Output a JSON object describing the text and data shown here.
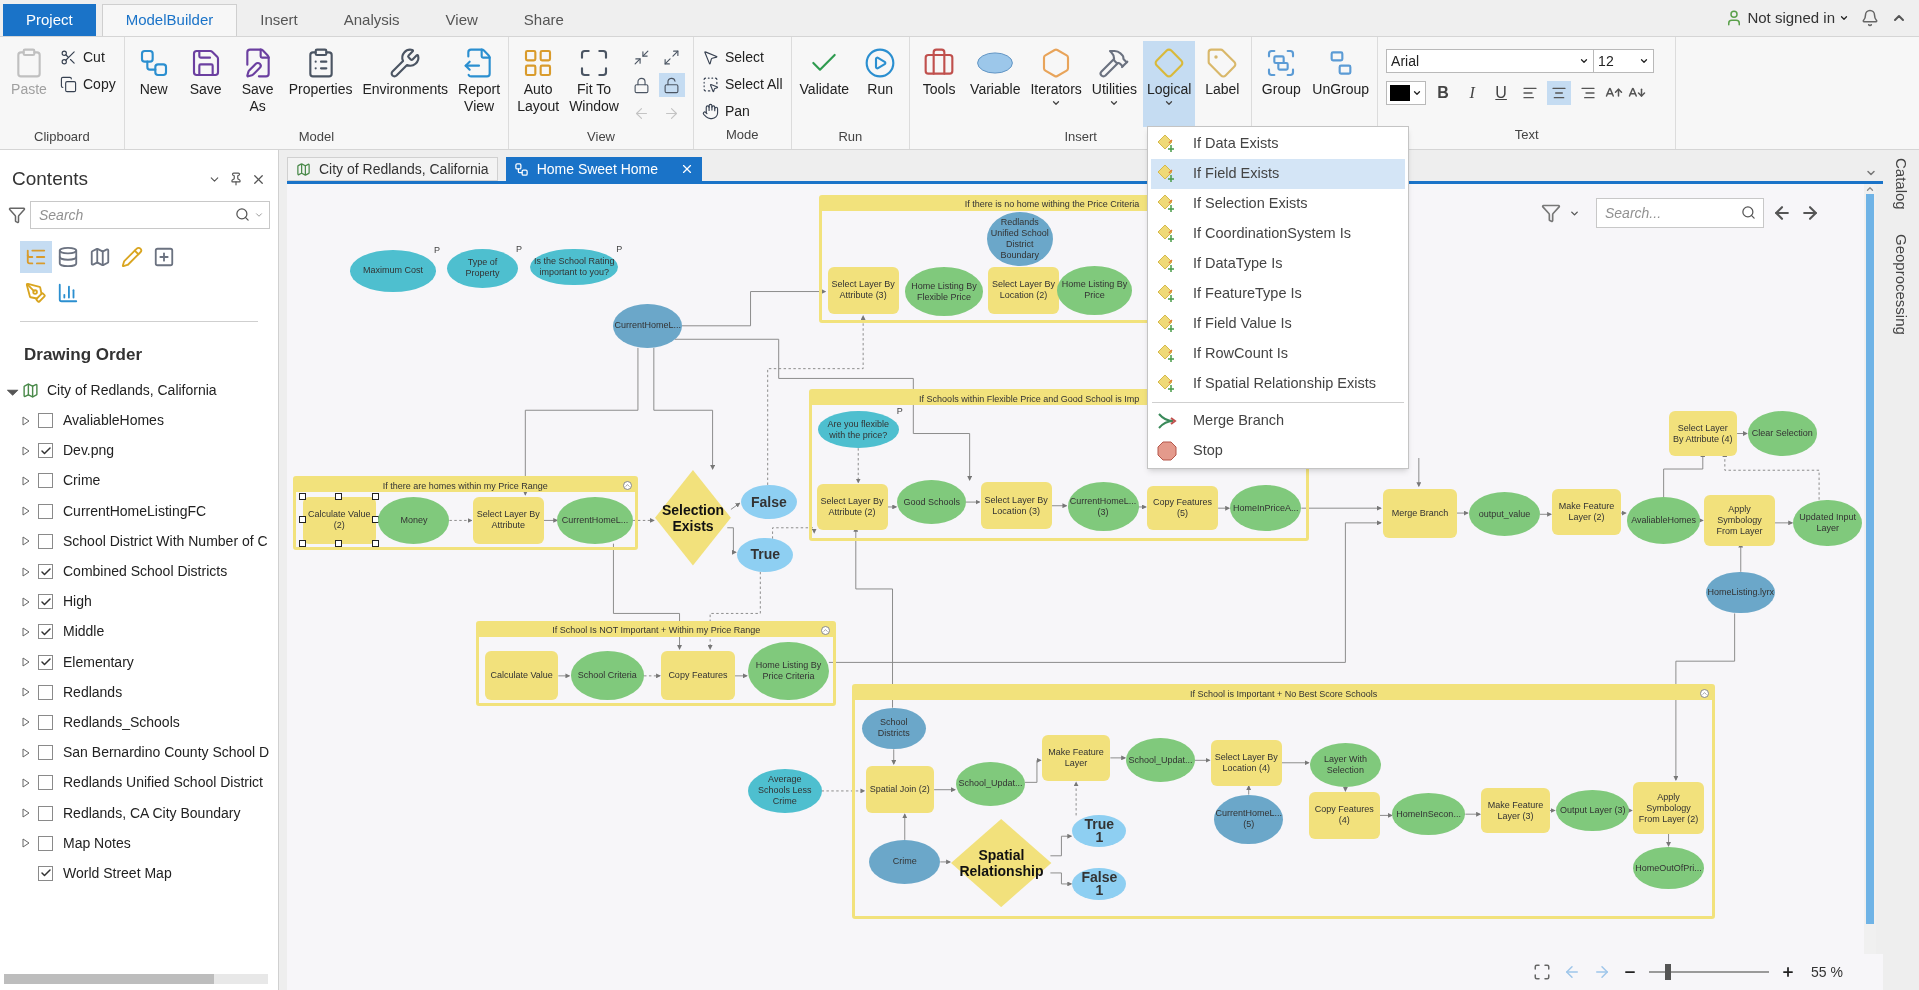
{
  "tabs": [
    {
      "label": "Project",
      "kind": "file",
      "selected": false
    },
    {
      "label": "ModelBuilder",
      "kind": "tab",
      "selected": true
    },
    {
      "label": "Insert",
      "kind": "tab",
      "selected": false
    },
    {
      "label": "Analysis",
      "kind": "tab",
      "selected": false
    },
    {
      "label": "View",
      "kind": "tab",
      "selected": false
    },
    {
      "label": "Share",
      "kind": "tab",
      "selected": false
    }
  ],
  "account": "Not signed in",
  "ribbon": [
    {
      "label": "Clipboard",
      "buttons": [
        {
          "kind": "large",
          "label": "Paste",
          "disabled": true
        },
        {
          "kind": "small",
          "label": "Cut",
          "disabled": false
        },
        {
          "kind": "small",
          "label": "Copy",
          "disabled": false
        }
      ]
    },
    {
      "label": "Model",
      "buttons": [
        {
          "kind": "large",
          "label": "New"
        },
        {
          "kind": "large",
          "label": "Save"
        },
        {
          "kind": "large",
          "label": "Save As"
        },
        {
          "kind": "large",
          "label": "Properties"
        },
        {
          "kind": "large",
          "label": "Environments"
        },
        {
          "kind": "large",
          "label": "Report View"
        }
      ]
    },
    {
      "label": "View",
      "buttons": [
        {
          "kind": "large",
          "label": "Auto Layout"
        },
        {
          "kind": "large",
          "label": "Fit To Window"
        },
        {
          "kind": "tool",
          "selected": false,
          "disabled": false
        },
        {
          "kind": "tool",
          "selected": false,
          "disabled": false
        },
        {
          "kind": "tool",
          "selected": false,
          "disabled": false
        },
        {
          "kind": "tool",
          "selected": true,
          "disabled": false
        },
        {
          "kind": "tool",
          "selected": false,
          "disabled": true
        },
        {
          "kind": "tool",
          "selected": false,
          "disabled": true
        }
      ]
    },
    {
      "label": "Mode",
      "buttons": [
        {
          "kind": "small",
          "label": "Select"
        },
        {
          "kind": "small",
          "label": "Select All"
        },
        {
          "kind": "small",
          "label": "Pan"
        }
      ]
    },
    {
      "label": "Run",
      "buttons": [
        {
          "kind": "large",
          "label": "Validate"
        },
        {
          "kind": "large",
          "label": "Run"
        }
      ]
    },
    {
      "label": "Insert",
      "buttons": [
        {
          "kind": "large",
          "label": "Tools",
          "pressed": false
        },
        {
          "kind": "large",
          "label": "Variable",
          "pressed": false
        },
        {
          "kind": "large",
          "label": "Iterators",
          "caret": true,
          "pressed": false
        },
        {
          "kind": "large",
          "label": "Utilities",
          "caret": true,
          "pressed": false
        },
        {
          "kind": "large",
          "label": "Logical",
          "caret": true,
          "pressed": true
        },
        {
          "kind": "large",
          "label": "Label",
          "pressed": false
        }
      ]
    },
    {
      "buttons": [
        {
          "kind": "large",
          "label": "Group"
        },
        {
          "kind": "large",
          "label": "UnGroup"
        }
      ]
    }
  ],
  "text_group": {
    "label": "Text",
    "font": "Arial",
    "size": "12",
    "styles": [
      {
        "label": "B"
      },
      {
        "label": "I"
      },
      {
        "label": "U"
      }
    ],
    "align": [
      {
        "kind": "left",
        "selected": false
      },
      {
        "kind": "center",
        "selected": true
      },
      {
        "kind": "right",
        "selected": false
      }
    ]
  },
  "contents": {
    "title": "Contents",
    "search_placeholder": "Search",
    "tools": [
      {
        "selected": true
      },
      {
        "selected": false
      },
      {
        "selected": false
      },
      {
        "selected": false
      },
      {
        "selected": false
      },
      {
        "selected": false
      },
      {
        "selected": false
      }
    ],
    "heading": "Drawing Order",
    "tree": {
      "label": "City of Redlands, California",
      "expanded": true,
      "children": [
        {
          "label": "AvaliableHomes",
          "checked": false,
          "expandable": true
        },
        {
          "label": "Dev.png",
          "checked": true,
          "expandable": true
        },
        {
          "label": "Crime",
          "checked": false,
          "expandable": true
        },
        {
          "label": "CurrentHomeListingFC",
          "checked": false,
          "expandable": true
        },
        {
          "label": "School District With Number of C",
          "checked": false,
          "expandable": true
        },
        {
          "label": "Combined School Districts",
          "checked": true,
          "expandable": true
        },
        {
          "label": "High",
          "checked": true,
          "expandable": true
        },
        {
          "label": "Middle",
          "checked": true,
          "expandable": true
        },
        {
          "label": "Elementary",
          "checked": true,
          "expandable": true
        },
        {
          "label": "Redlands",
          "checked": false,
          "expandable": true
        },
        {
          "label": "Redlands_Schools",
          "checked": false,
          "expandable": true
        },
        {
          "label": "San Bernardino County School D",
          "checked": false,
          "expandable": true
        },
        {
          "label": "Redlands Unified School District",
          "checked": false,
          "expandable": true
        },
        {
          "label": "Redlands, CA City Boundary",
          "checked": false,
          "expandable": true
        },
        {
          "label": "Map Notes",
          "checked": false,
          "expandable": true
        },
        {
          "label": "World Street Map",
          "checked": true,
          "expandable": false
        }
      ]
    }
  },
  "doc_tabs": [
    {
      "label": "City of Redlands, California",
      "kind": "map",
      "selected": false
    },
    {
      "label": "Home Sweet Home",
      "kind": "model",
      "selected": true
    }
  ],
  "side_tabs": [
    "Catalog",
    "Geoprocessing"
  ],
  "canvas": {
    "search_placeholder": "Search...",
    "groups": [
      {
        "title": "If there is no home withing the Price Criteria"
      },
      {
        "title": "If Schools within Flexible Price and Good School is Imp"
      },
      {
        "title": "If there are homes within my Price Range"
      },
      {
        "title": "If School Is NOT Important + Within my Price Range"
      },
      {
        "title": "If School is Important + No Best Score Schools"
      }
    ],
    "nodes": [
      {
        "kind": "parameter",
        "label": "Maximum Cost",
        "tag": "P",
        "selected": false
      },
      {
        "kind": "parameter",
        "label": "Type of Property",
        "tag": "P",
        "selected": false
      },
      {
        "kind": "parameter",
        "label": "Is the School Rating important to you?",
        "tag": "P",
        "selected": false
      },
      {
        "kind": "data",
        "label": "CurrentHomeL...",
        "selected": false
      },
      {
        "kind": "data",
        "label": "Redlands Unified School District Boundary",
        "selected": false
      },
      {
        "kind": "process",
        "label": "Select Layer By Attribute (3)",
        "selected": false
      },
      {
        "kind": "derived",
        "label": "Home Listing By Flexible Price",
        "selected": false
      },
      {
        "kind": "process",
        "label": "Select Layer By Location (2)",
        "selected": false
      },
      {
        "kind": "derived",
        "label": "Home Listing By Price",
        "selected": false
      },
      {
        "kind": "parameter",
        "label": "Are you flexible with the price?",
        "tag": "P",
        "selected": false
      },
      {
        "kind": "process",
        "label": "Select Layer By Attribute (4)",
        "selected": false
      },
      {
        "kind": "derived",
        "label": "Clear Selection",
        "selected": false
      },
      {
        "kind": "process",
        "label": "Calculate Value (2)",
        "selected": true
      },
      {
        "kind": "derived",
        "label": "Money",
        "selected": false
      },
      {
        "kind": "process",
        "label": "Select Layer By Attribute",
        "selected": false
      },
      {
        "kind": "derived",
        "label": "CurrentHomeL...",
        "selected": false
      },
      {
        "kind": "condition",
        "label": "Selection\nExists",
        "selected": false
      },
      {
        "kind": "boolean",
        "label": "False",
        "selected": false
      },
      {
        "kind": "boolean",
        "label": "True",
        "selected": false
      },
      {
        "kind": "process",
        "label": "Select Layer By Attribute (2)",
        "selected": false
      },
      {
        "kind": "derived",
        "label": "Good Schools",
        "selected": false
      },
      {
        "kind": "process",
        "label": "Select Layer By Location (3)",
        "selected": false
      },
      {
        "kind": "derived",
        "label": "CurrentHomeL... (3)",
        "selected": false
      },
      {
        "kind": "process",
        "label": "Copy Features (5)",
        "selected": false
      },
      {
        "kind": "derived",
        "label": "HomeInPriceA...",
        "selected": false
      },
      {
        "kind": "process",
        "label": "Merge Branch",
        "selected": false
      },
      {
        "kind": "derived",
        "label": "output_value",
        "selected": false
      },
      {
        "kind": "process",
        "label": "Make Feature Layer (2)",
        "selected": false
      },
      {
        "kind": "derived",
        "label": "AvaliableHomes",
        "selected": false
      },
      {
        "kind": "process",
        "label": "Apply Symbology From Layer",
        "selected": false
      },
      {
        "kind": "derived",
        "label": "Updated Input Layer",
        "selected": false
      },
      {
        "kind": "data",
        "label": "HomeListing.lyrx",
        "selected": false
      },
      {
        "kind": "process",
        "label": "Calculate Value",
        "selected": false
      },
      {
        "kind": "derived",
        "label": "School Criteria",
        "selected": false
      },
      {
        "kind": "process",
        "label": "Copy Features",
        "selected": false
      },
      {
        "kind": "derived",
        "label": "Home Listing By Price Criteria",
        "selected": false
      },
      {
        "kind": "data",
        "label": "School Districts",
        "selected": false
      },
      {
        "kind": "parameter",
        "label": "Average Schools Less Crime",
        "selected": false
      },
      {
        "kind": "process",
        "label": "Spatial Join (2)",
        "selected": false
      },
      {
        "kind": "derived",
        "label": "School_Updat...",
        "selected": false
      },
      {
        "kind": "process",
        "label": "Make Feature Layer",
        "selected": false
      },
      {
        "kind": "derived",
        "label": "School_Updat...",
        "selected": false
      },
      {
        "kind": "process",
        "label": "Select Layer By Location (4)",
        "selected": false
      },
      {
        "kind": "derived",
        "label": "Layer With Selection",
        "selected": false
      },
      {
        "kind": "data",
        "label": "CurrentHomeL... (5)",
        "selected": false
      },
      {
        "kind": "process",
        "label": "Copy Features (4)",
        "selected": false
      },
      {
        "kind": "derived",
        "label": "HomeInSecon...",
        "selected": false
      },
      {
        "kind": "process",
        "label": "Make Feature Layer (3)",
        "selected": false
      },
      {
        "kind": "derived",
        "label": "Output Layer (3)",
        "selected": false
      },
      {
        "kind": "process",
        "label": "Apply Symbology From Layer (2)",
        "selected": false
      },
      {
        "kind": "derived",
        "label": "HomeOutOfPri...",
        "selected": false
      },
      {
        "kind": "data",
        "label": "Crime",
        "selected": false
      },
      {
        "kind": "condition",
        "label": "Spatial\nRelationship",
        "selected": false
      },
      {
        "kind": "boolean",
        "label": "True\n1",
        "selected": false
      },
      {
        "kind": "boolean",
        "label": "False\n1",
        "selected": false
      }
    ]
  },
  "zoom": {
    "level": 0.14,
    "reading": "55 %"
  },
  "menu": {
    "items": [
      {
        "kind": "condition",
        "label": "If Data Exists",
        "selected": false
      },
      {
        "kind": "condition",
        "label": "If Field Exists",
        "selected": true
      },
      {
        "kind": "condition",
        "label": "If Selection Exists",
        "selected": false
      },
      {
        "kind": "condition",
        "label": "If CoordinationSystem Is",
        "selected": false
      },
      {
        "kind": "condition",
        "label": "If DataType Is",
        "selected": false
      },
      {
        "kind": "condition",
        "label": "If FeatureType Is",
        "selected": false
      },
      {
        "kind": "condition",
        "label": "If Field Value Is",
        "selected": false
      },
      {
        "kind": "condition",
        "label": "If RowCount Is",
        "selected": false
      },
      {
        "kind": "condition",
        "label": "If Spatial Relationship Exists",
        "selected": false
      },
      {
        "kind": "merge",
        "label": "Merge Branch",
        "selected": false
      },
      {
        "kind": "stop",
        "label": "Stop",
        "selected": false
      }
    ]
  }
}
